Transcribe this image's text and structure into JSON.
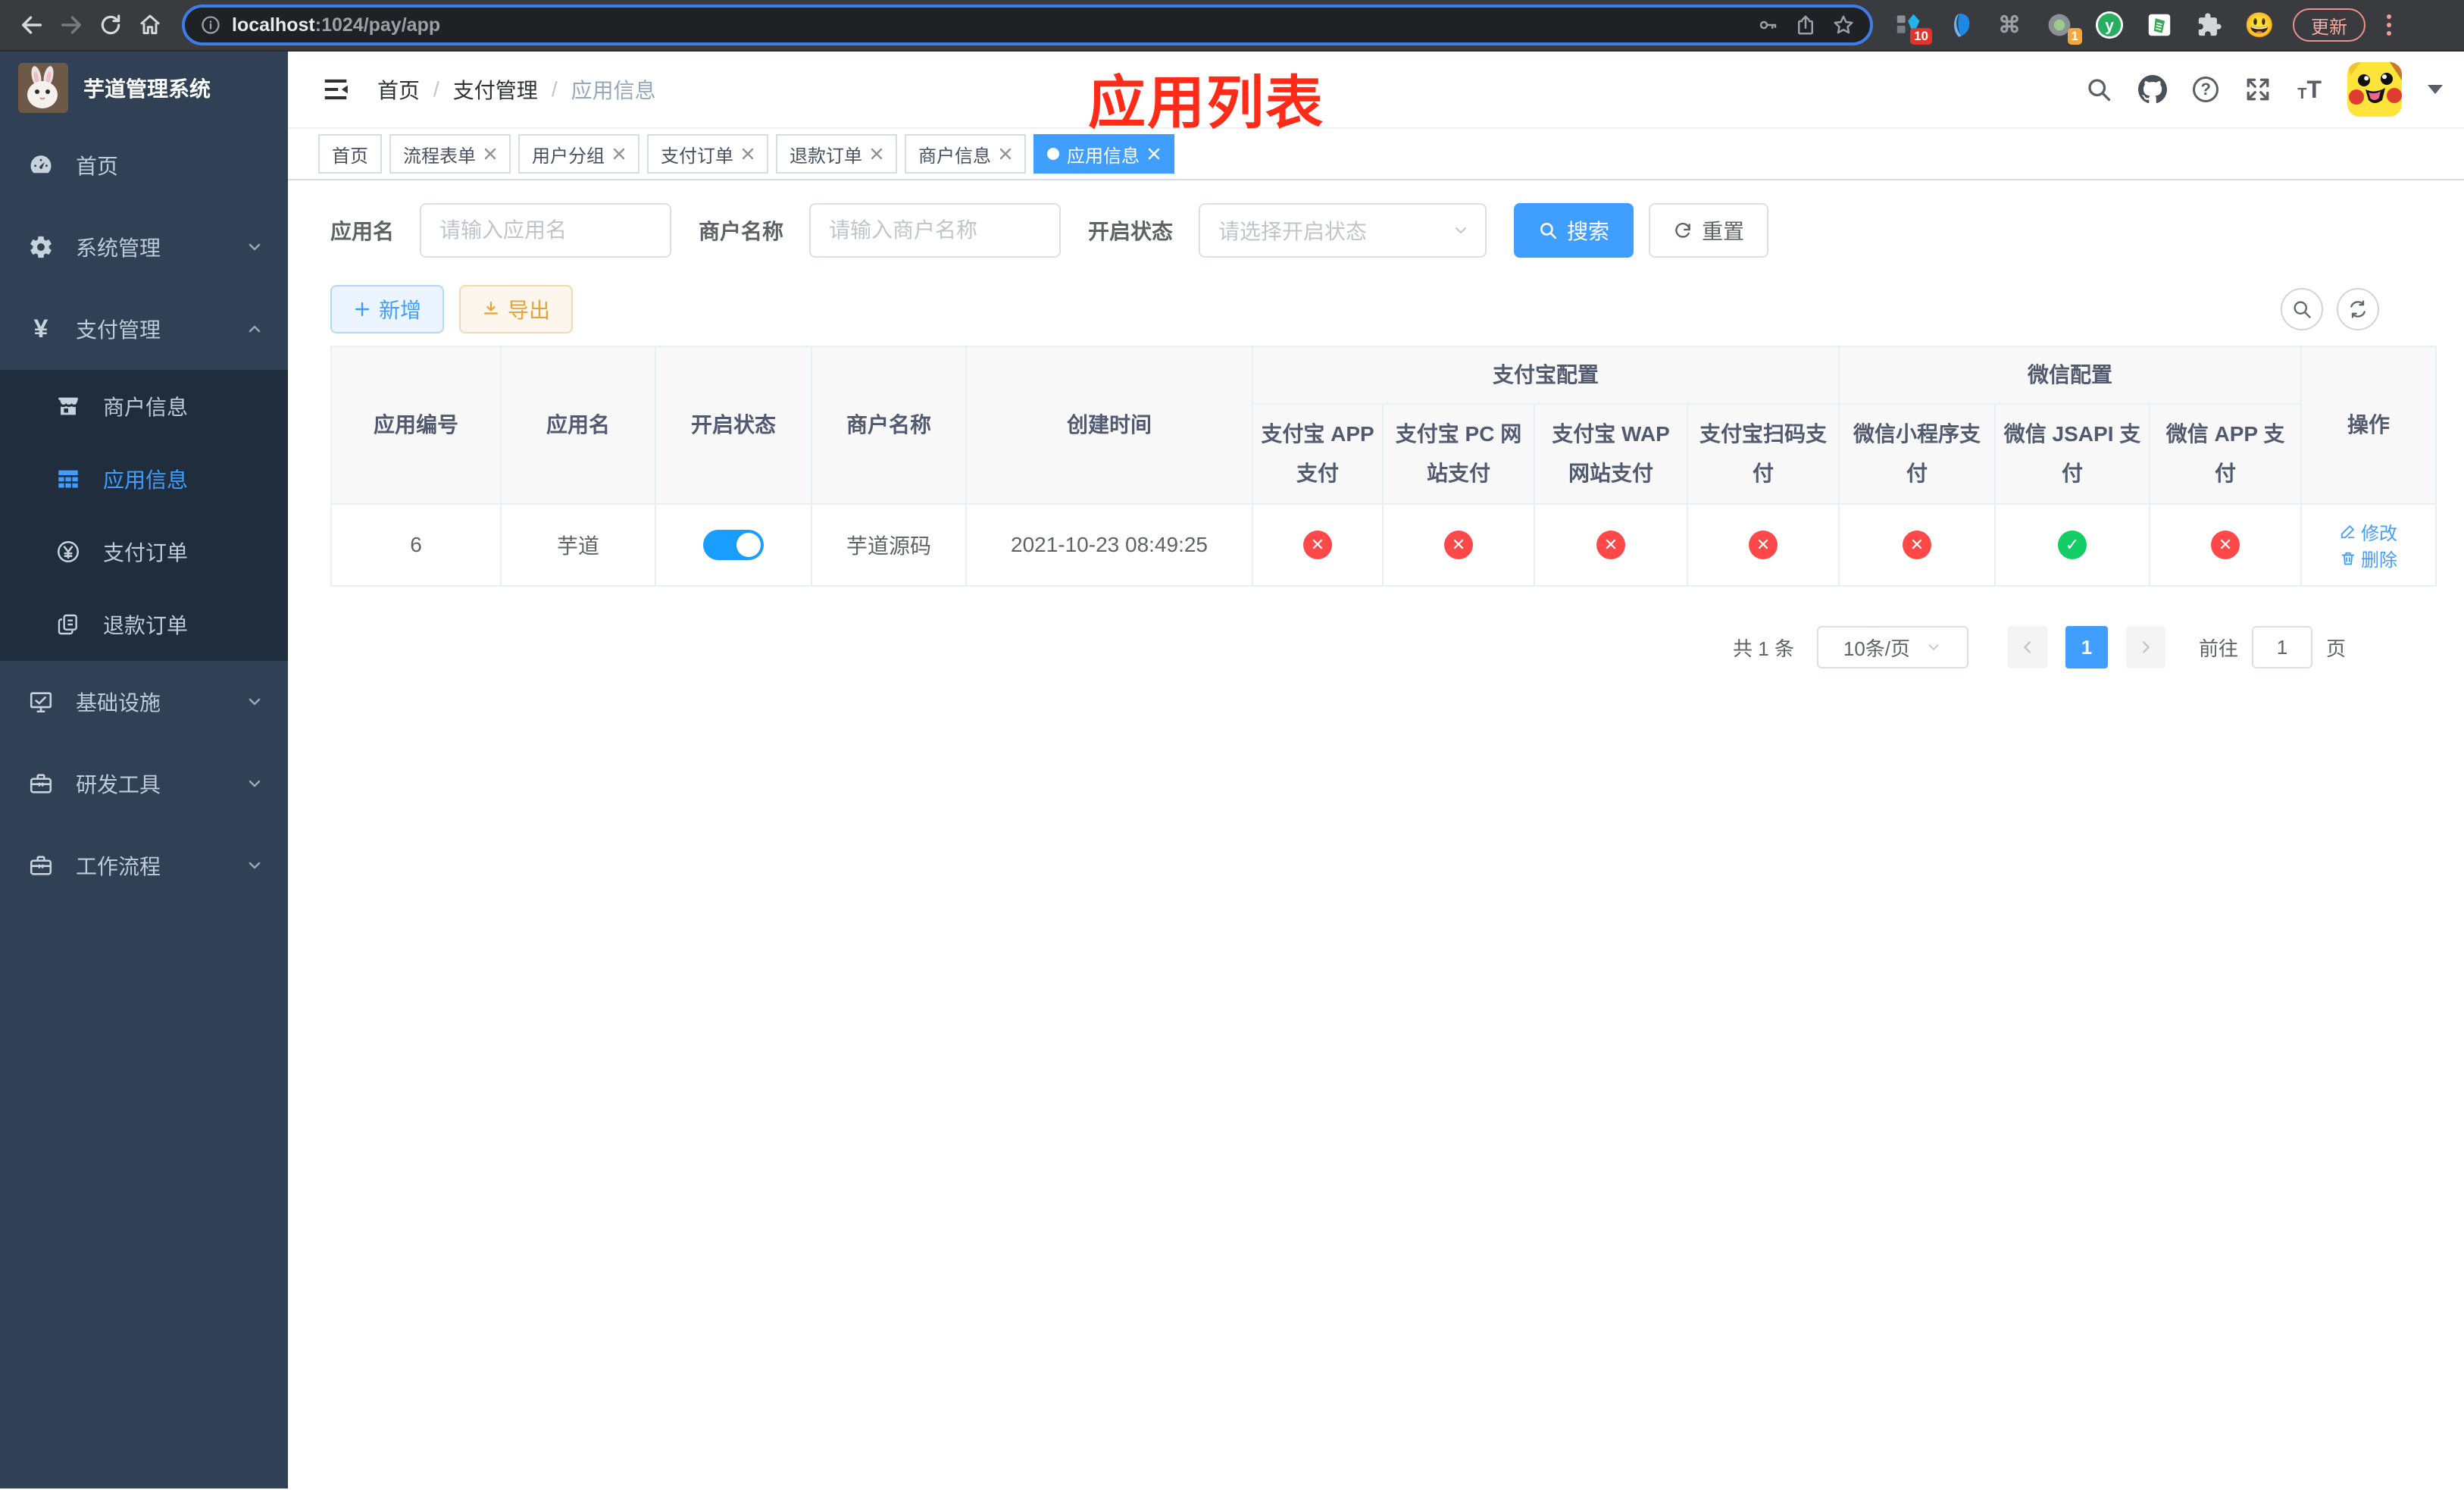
{
  "browser": {
    "url_host": "localhost",
    "url_path": ":1024/pay/app",
    "ext_badge_1": "10",
    "ext_badge_2": "1",
    "update_label": "更新"
  },
  "sidebar": {
    "logo_title": "芋道管理系统",
    "menu": {
      "home": "首页",
      "system": "系统管理",
      "payment": "支付管理",
      "merchant_info": "商户信息",
      "app_info": "应用信息",
      "pay_order": "支付订单",
      "refund_order": "退款订单",
      "infrastructure": "基础设施",
      "dev_tools": "研发工具",
      "workflow": "工作流程"
    }
  },
  "header": {
    "breadcrumb": {
      "b1": "首页",
      "b2": "支付管理",
      "b3": "应用信息",
      "separator": "/"
    },
    "annotation": "应用列表"
  },
  "tabs": [
    {
      "label": "首页"
    },
    {
      "label": "流程表单"
    },
    {
      "label": "用户分组"
    },
    {
      "label": "支付订单"
    },
    {
      "label": "退款订单"
    },
    {
      "label": "商户信息"
    },
    {
      "label": "应用信息"
    }
  ],
  "filters": {
    "app_name_label": "应用名",
    "app_name_placeholder": "请输入应用名",
    "merchant_label": "商户名称",
    "merchant_placeholder": "请输入商户名称",
    "status_label": "开启状态",
    "status_placeholder": "请选择开启状态",
    "search_label": "搜索",
    "reset_label": "重置"
  },
  "toolbar": {
    "add_label": "新增",
    "export_label": "导出"
  },
  "table": {
    "groups": {
      "alipay": "支付宝配置",
      "wechat": "微信配置"
    },
    "columns": {
      "id": "应用编号",
      "name": "应用名",
      "status": "开启状态",
      "merchant": "商户名称",
      "created": "创建时间",
      "alipay_app": "支付宝 APP 支付",
      "alipay_pc": "支付宝 PC 网站支付",
      "alipay_wap": "支付宝 WAP 网站支付",
      "alipay_qr": "支付宝扫码支付",
      "wx_mini": "微信小程序支付",
      "wx_jsapi": "微信 JSAPI 支付",
      "wx_app": "微信 APP 支付",
      "actions": "操作"
    },
    "row": {
      "id": "6",
      "name": "芋道",
      "enabled": true,
      "merchant": "芋道源码",
      "created": "2021-10-23 08:49:25",
      "pay_status": [
        false,
        false,
        false,
        false,
        false,
        true,
        false
      ],
      "edit_label": "修改",
      "delete_label": "删除"
    },
    "status_glyphs": {
      "on": "✓",
      "off": "✕"
    }
  },
  "pagination": {
    "total": "共 1 条",
    "page_size": "10条/页",
    "current_page": "1",
    "goto_label": "前往",
    "goto_value": "1",
    "goto_unit": "页"
  },
  "colors": {
    "accent": "#409EFF",
    "danger": "#ff4949",
    "success": "#13ce66",
    "warning": "#e6a23c",
    "annotation": "#fe2b19"
  }
}
